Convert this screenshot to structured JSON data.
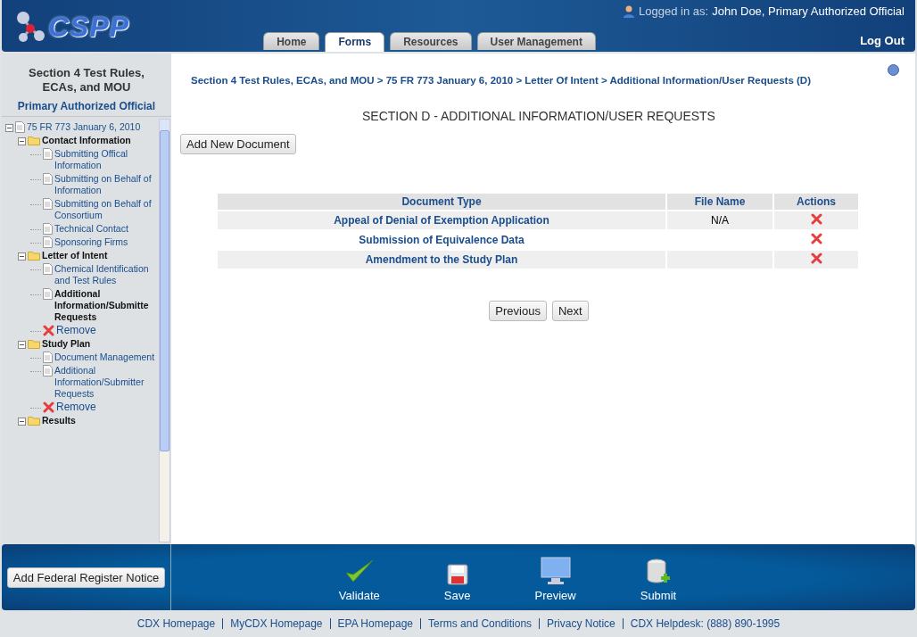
{
  "header": {
    "logo": "CSPP",
    "user_label": "Logged in as:",
    "user_name": "John Doe, Primary Authorized Official",
    "logout": "Log Out",
    "tabs": [
      {
        "label": "Home",
        "selected": false
      },
      {
        "label": "Forms",
        "selected": true
      },
      {
        "label": "Resources",
        "selected": false
      },
      {
        "label": "User Management",
        "selected": false
      }
    ]
  },
  "sidebar": {
    "title": "Section 4 Test Rules, ECAs, and MOU",
    "role": "Primary Authorized Official",
    "tree": [
      {
        "label": "75 FR 773 January 6, 2010",
        "kind": "root",
        "expanded": true,
        "children": [
          {
            "label": "Contact Information",
            "kind": "folder",
            "expanded": true,
            "children": [
              {
                "label": "Submitting Offical Information",
                "kind": "document",
                "selected": false
              },
              {
                "label": "Submitting on Behalf of Information",
                "kind": "document",
                "selected": false
              },
              {
                "label": "Submitting on Behalf of Consortium",
                "kind": "document",
                "selected": false
              },
              {
                "label": "Technical Contact",
                "kind": "document",
                "selected": false
              },
              {
                "label": "Sponsoring Firms",
                "kind": "document",
                "selected": false
              }
            ]
          },
          {
            "label": "Letter of Intent",
            "kind": "folder",
            "expanded": true,
            "children": [
              {
                "label": "Chemical Identification and Test Rules",
                "kind": "document",
                "selected": false
              },
              {
                "label": "Additional Information/Submitte Requests",
                "kind": "document",
                "selected": true
              },
              {
                "label": "Remove",
                "kind": "remove"
              }
            ]
          },
          {
            "label": "Study Plan",
            "kind": "folder",
            "expanded": true,
            "children": [
              {
                "label": "Document Management",
                "kind": "document",
                "selected": false
              },
              {
                "label": "Additional Information/Submitter Requests",
                "kind": "document",
                "selected": false
              },
              {
                "label": "Remove",
                "kind": "remove"
              }
            ]
          },
          {
            "label": "Results",
            "kind": "folder",
            "expanded": true
          }
        ]
      }
    ],
    "button": "Add Federal Register Notice"
  },
  "breadcrumb": "Section 4 Test Rules, ECAs, and MOU > 75 FR 773 January 6, 2010 > Letter Of Intent > Additional Information/User Requests (D)",
  "heading": "SECTION D - ADDITIONAL INFORMATION/USER REQUESTS",
  "add_button": "Add New Document",
  "table": {
    "columns": [
      "Document Type",
      "File Name",
      "Actions"
    ],
    "rows": [
      {
        "document_type": "Appeal of Denial of Exemption Application",
        "file_name": "N/A"
      },
      {
        "document_type": "Submission of Equivalence Data"
      },
      {
        "document_type": "Amendment to the Study Plan"
      }
    ]
  },
  "pager": [
    "Previous",
    "Next"
  ],
  "actions": [
    {
      "label": "Validate",
      "kind": "validate"
    },
    {
      "label": "Save",
      "kind": "save"
    },
    {
      "label": "Preview",
      "kind": "preview"
    },
    {
      "label": "Submit",
      "kind": "submit"
    }
  ],
  "footer_links": [
    "CDX Homepage",
    "MyCDX Homepage",
    "EPA Homepage",
    "Terms and Conditions",
    "Privacy Notice",
    "CDX Helpdesk: (888) 890-1995"
  ]
}
